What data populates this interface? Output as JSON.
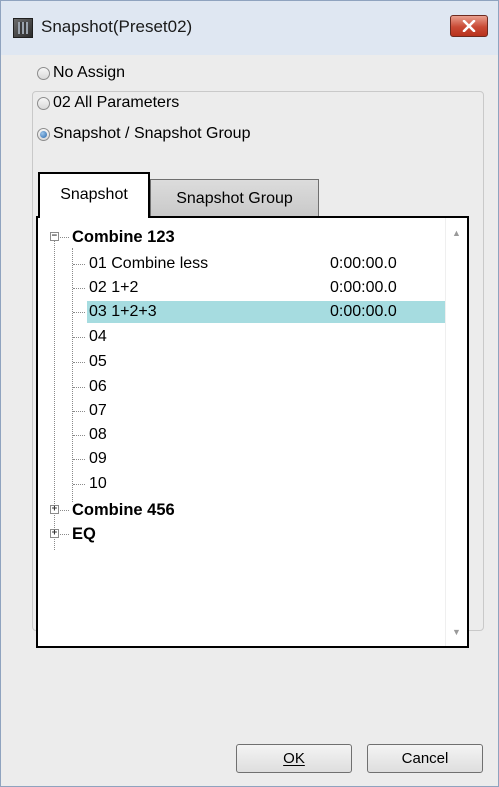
{
  "window": {
    "title": "Snapshot(Preset02)"
  },
  "options": [
    {
      "label": "No Assign",
      "checked": false
    },
    {
      "label": "02 All Parameters",
      "checked": false
    },
    {
      "label": "Snapshot / Snapshot Group",
      "checked": true
    }
  ],
  "tabs": [
    {
      "label": "Snapshot",
      "active": true
    },
    {
      "label": "Snapshot Group",
      "active": false
    }
  ],
  "tree": {
    "groups": [
      {
        "name": "Combine 123",
        "expanded": true,
        "items": [
          {
            "label": "01 Combine less",
            "time": "0:00:00.0",
            "selected": false
          },
          {
            "label": "02 1+2",
            "time": "0:00:00.0",
            "selected": false
          },
          {
            "label": "03 1+2+3",
            "time": "0:00:00.0",
            "selected": true
          },
          {
            "label": "04",
            "time": "",
            "selected": false
          },
          {
            "label": "05",
            "time": "",
            "selected": false
          },
          {
            "label": "06",
            "time": "",
            "selected": false
          },
          {
            "label": "07",
            "time": "",
            "selected": false
          },
          {
            "label": "08",
            "time": "",
            "selected": false
          },
          {
            "label": "09",
            "time": "",
            "selected": false
          },
          {
            "label": "10",
            "time": "",
            "selected": false
          }
        ]
      },
      {
        "name": "Combine 456",
        "expanded": false
      },
      {
        "name": "EQ",
        "expanded": false
      }
    ],
    "expander_expanded": "−",
    "expander_collapsed": "+"
  },
  "buttons": {
    "ok": "OK",
    "cancel": "Cancel"
  },
  "colors": {
    "selection": "#a6dce0",
    "close_button": "#c94a35"
  }
}
